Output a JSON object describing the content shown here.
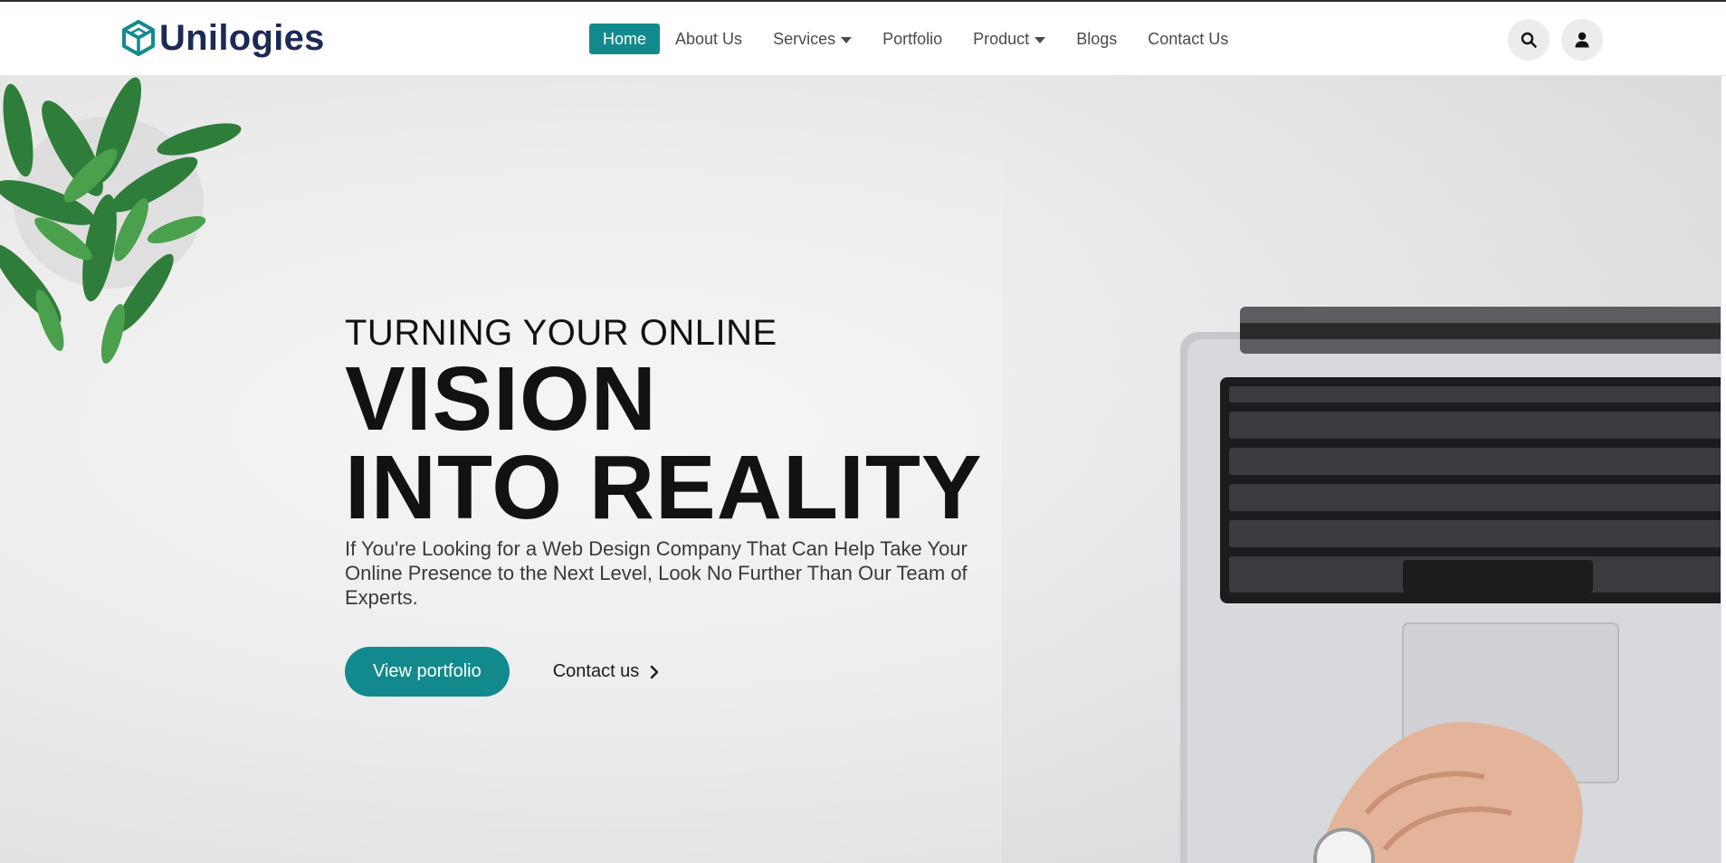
{
  "brand": {
    "name": "Unilogies",
    "accent_color": "#128a8d",
    "logo_color": "#1c2a56",
    "logo_icon": "hexagon-cube-icon"
  },
  "nav": {
    "items": [
      {
        "label": "Home",
        "active": true,
        "dropdown": false
      },
      {
        "label": "About Us",
        "active": false,
        "dropdown": false
      },
      {
        "label": "Services",
        "active": false,
        "dropdown": true
      },
      {
        "label": "Portfolio",
        "active": false,
        "dropdown": false
      },
      {
        "label": "Product",
        "active": false,
        "dropdown": true
      },
      {
        "label": "Blogs",
        "active": false,
        "dropdown": false
      },
      {
        "label": "Contact Us",
        "active": false,
        "dropdown": false
      }
    ],
    "search_icon": "search-icon",
    "account_icon": "user-icon"
  },
  "hero": {
    "eyebrow": "TURNING YOUR ONLINE",
    "headline_line1": "VISION",
    "headline_line2": "INTO REALITY",
    "subtext": "If You're Looking for a Web Design Company That Can Help Take Your Online Presence to the Next Level, Look No Further Than Our Team of Experts.",
    "primary_cta": "View portfolio",
    "secondary_cta": "Contact us",
    "secondary_icon": "chevron-right-icon"
  }
}
